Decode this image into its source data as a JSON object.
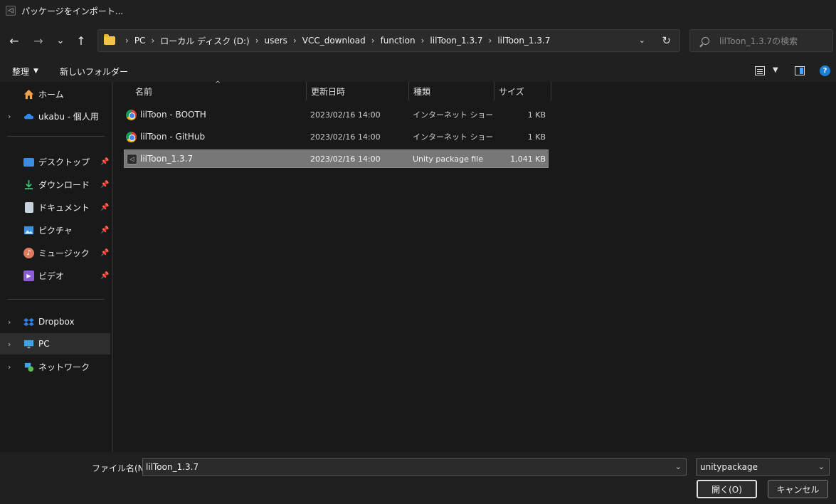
{
  "window": {
    "title": "パッケージをインポート..."
  },
  "nav": {
    "back": "←",
    "forward": "→",
    "recent": "⌄",
    "up": "↑",
    "breadcrumbs": [
      "PC",
      "ローカル ディスク (D:)",
      "users",
      "VCC_download",
      "function",
      "lilToon_1.3.7",
      "lilToon_1.3.7"
    ],
    "search_placeholder": "lilToon_1.3.7の検索"
  },
  "toolbar": {
    "organize": "整理",
    "new_folder": "新しいフォルダー"
  },
  "sidebar": {
    "home": "ホーム",
    "onedrive": "ukabu - 個人用",
    "quick": [
      "デスクトップ",
      "ダウンロード",
      "ドキュメント",
      "ピクチャ",
      "ミュージック",
      "ビデオ"
    ],
    "dropbox": "Dropbox",
    "pc": "PC",
    "network": "ネットワーク"
  },
  "columns": {
    "name": "名前",
    "date": "更新日時",
    "type": "種類",
    "size": "サイズ"
  },
  "files": [
    {
      "name": "lilToon - BOOTH",
      "date": "2023/02/16 14:00",
      "type": "インターネット ショート...",
      "size": "1 KB"
    },
    {
      "name": "lilToon - GitHub",
      "date": "2023/02/16 14:00",
      "type": "インターネット ショート...",
      "size": "1 KB"
    },
    {
      "name": "lilToon_1.3.7",
      "date": "2023/02/16 14:00",
      "type": "Unity package file",
      "size": "1,041 KB"
    }
  ],
  "bottom": {
    "filename_label": "ファイル名(N):",
    "filename_value": "lilToon_1.3.7",
    "filetype_value": "unitypackage",
    "open": "開く(O)",
    "cancel": "キャンセル"
  },
  "colors": {
    "accent": "#1e7fd8",
    "folder": "#f4c542",
    "selected_row": "#777777"
  }
}
